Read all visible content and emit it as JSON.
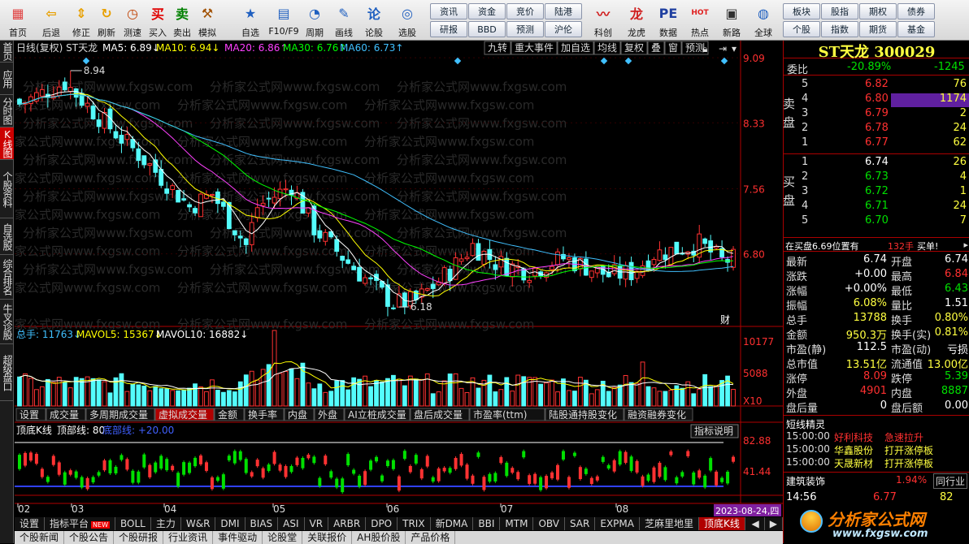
{
  "toolbar": {
    "nav": [
      {
        "label": "首页",
        "icon": "home-icon"
      },
      {
        "label": "后退",
        "icon": "back-arrow-icon"
      },
      {
        "label": "修正",
        "icon": "up-down-arrow-icon"
      },
      {
        "label": "刷新",
        "icon": "refresh-icon"
      },
      {
        "label": "测速",
        "icon": "clock-icon"
      },
      {
        "label": "买入",
        "icon": "buy-icon"
      },
      {
        "label": "卖出",
        "icon": "sell-icon"
      },
      {
        "label": "模拟",
        "icon": "hammer-icon"
      }
    ],
    "tools": [
      {
        "label": "自选",
        "icon": "favorites-icon"
      },
      {
        "label": "F10/F9",
        "icon": "f10-icon"
      },
      {
        "label": "周期",
        "icon": "period-icon"
      },
      {
        "label": "画线",
        "icon": "pen-icon"
      },
      {
        "label": "论股",
        "icon": "discuss-icon"
      },
      {
        "label": "选股",
        "icon": "stock-picker-icon"
      }
    ],
    "menu_grid": [
      [
        "资讯",
        "资金",
        "竞价",
        "陆港"
      ],
      [
        "研报",
        "BBD",
        "预测",
        "沪伦"
      ]
    ],
    "tools2": [
      {
        "label": "科创",
        "icon": "kechuang-icon"
      },
      {
        "label": "龙虎",
        "icon": "longhu-icon"
      },
      {
        "label": "数据",
        "icon": "pe-data-icon"
      },
      {
        "label": "热点",
        "icon": "hot-icon"
      },
      {
        "label": "新路",
        "icon": "new-road-icon"
      },
      {
        "label": "全球",
        "icon": "globe-icon"
      }
    ],
    "menu_grid2": [
      [
        "板块",
        "股指",
        "期权",
        "债券"
      ],
      [
        "个股",
        "指数",
        "期货",
        "基金"
      ]
    ]
  },
  "sidebar": [
    "首页",
    "应用",
    "分时图",
    "K线图",
    "个股资料",
    "自选股",
    "综合排名",
    "牛叉诊股",
    "超级盘口"
  ],
  "chart": {
    "header": "日线(复权)  ST天龙",
    "ma": [
      {
        "label": "MA5: 6.89↓",
        "color": "#ffffff"
      },
      {
        "label": "MA10: 6.94↓",
        "color": "#ffff00"
      },
      {
        "label": "MA20: 6.86↑",
        "color": "#ff40ff"
      },
      {
        "label": "MA30: 6.76↑",
        "color": "#00ff00"
      },
      {
        "label": "MA60: 6.73↑",
        "color": "#40c0ff"
      }
    ],
    "tools": [
      "九转",
      "重大事件",
      "加自选",
      "均线",
      "复权",
      "叠",
      "窗",
      "预测"
    ],
    "price_axis": [
      "9.09",
      "8.33",
      "7.56",
      "6.80"
    ],
    "high_label": "8.94",
    "low_label": "6.18",
    "cai_label": "财",
    "watermark": "分析家公式网www.fxgsw.com",
    "vol_header": {
      "total": "总手: 11763↓",
      "mavol5": "MAVOL5: 15367↓",
      "mavol10": "MAVOL10: 16882↓"
    },
    "vol_axis": [
      "10177",
      "5088",
      "X10"
    ],
    "vol_tabs": [
      "设置",
      "成交量",
      "多周期成交量",
      "虚拟成交量",
      "金额",
      "换手率",
      "内盘",
      "外盘",
      "AI立桩成交量",
      "盘后成交量",
      "市盈率(ttm)",
      "陆股通持股变化",
      "融资融券变化"
    ],
    "ind_header": {
      "name": "顶底K线",
      "top": "顶部线: 80",
      "bottom": "底部线: +20.00",
      "help": "指标说明"
    },
    "ind_axis": [
      "82.88",
      "41.44"
    ],
    "date_axis": [
      "02",
      "03",
      "04",
      "05",
      "06",
      "07",
      "08"
    ],
    "date_current": "2023-08-24,四",
    "bottom_tabs": [
      "设置",
      "指标平台",
      "BOLL",
      "主力",
      "W&R",
      "DMI",
      "BIAS",
      "ASI",
      "VR",
      "ARBR",
      "DPO",
      "TRIX",
      "新DMA",
      "BBI",
      "MTM",
      "OBV",
      "SAR",
      "EXPMA",
      "芝麻里地里",
      "顶底K线"
    ],
    "new_badge": "NEW",
    "bottom_tabs2": [
      "个股新闻",
      "个股公告",
      "个股研报",
      "行业资讯",
      "事件驱动",
      "论股堂",
      "关联报价",
      "AH股价股",
      "产品价格"
    ]
  },
  "right": {
    "title": "ST天龙 300029",
    "weibi_label": "委比",
    "weibi": "-20.89%",
    "weicha": "-1245",
    "sell_label": "卖盘",
    "buy_label": "买盘",
    "sell": [
      {
        "lvl": "5",
        "price": "6.82",
        "vol": "76"
      },
      {
        "lvl": "4",
        "price": "6.80",
        "vol": "1174"
      },
      {
        "lvl": "3",
        "price": "6.79",
        "vol": "2"
      },
      {
        "lvl": "2",
        "price": "6.78",
        "vol": "24"
      },
      {
        "lvl": "1",
        "price": "6.77",
        "vol": "62"
      }
    ],
    "buy": [
      {
        "lvl": "1",
        "price": "6.74",
        "vol": "26"
      },
      {
        "lvl": "2",
        "price": "6.73",
        "vol": "4"
      },
      {
        "lvl": "3",
        "price": "6.72",
        "vol": "1"
      },
      {
        "lvl": "4",
        "price": "6.71",
        "vol": "24"
      },
      {
        "lvl": "5",
        "price": "6.70",
        "vol": "7"
      }
    ],
    "pos_text": "在买盘6.69位置有",
    "pos_vol": "132手",
    "pos_btn": "买单!",
    "quotes": [
      {
        "l1": "最新",
        "v1": "6.74",
        "l2": "开盘",
        "v2": "6.74",
        "c1": "#fff",
        "c2": "#fff"
      },
      {
        "l1": "涨跌",
        "v1": "+0.00",
        "l2": "最高",
        "v2": "6.84",
        "c1": "#fff",
        "c2": "#ff3030"
      },
      {
        "l1": "涨幅",
        "v1": "+0.00%",
        "l2": "最低",
        "v2": "6.43",
        "c1": "#fff",
        "c2": "#00e000"
      },
      {
        "l1": "振幅",
        "v1": "6.08%",
        "l2": "量比",
        "v2": "1.51",
        "c1": "#ffff40",
        "c2": "#fff"
      },
      {
        "l1": "总手",
        "v1": "13788",
        "l2": "换手",
        "v2": "0.80%",
        "c1": "#ffff40",
        "c2": "#ffff40"
      },
      {
        "l1": "金额",
        "v1": "950.3万",
        "l2": "换手(实)",
        "v2": "0.81%",
        "c1": "#ffff40",
        "c2": "#ffff40"
      },
      {
        "l1": "市盈(静)",
        "v1": "112.5",
        "l2": "市盈(动)",
        "v2": "亏损",
        "c1": "#fff",
        "c2": "#fff"
      },
      {
        "l1": "总市值",
        "v1": "13.51亿",
        "l2": "流通值",
        "v2": "13.00亿",
        "c1": "#ffff40",
        "c2": "#ffff40"
      },
      {
        "l1": "涨停",
        "v1": "8.09",
        "l2": "跌停",
        "v2": "5.39",
        "c1": "#ff3030",
        "c2": "#00e000"
      },
      {
        "l1": "外盘",
        "v1": "4901",
        "l2": "内盘",
        "v2": "8887",
        "c1": "#ff3030",
        "c2": "#00e000"
      },
      {
        "l1": "盘后量",
        "v1": "0",
        "l2": "盘后额",
        "v2": "0.00",
        "c1": "#fff",
        "c2": "#fff"
      }
    ],
    "news_title": "短线精灵",
    "news": [
      {
        "time": "15:00:00",
        "stock": "好利科技",
        "event": "急速拉升",
        "color": "#ff3030"
      },
      {
        "time": "15:00:00",
        "stock": "华鑫股份",
        "event": "打开涨停板",
        "color": "#ffff40"
      },
      {
        "time": "15:00:00",
        "stock": "天晟新材",
        "event": "打开涨停板",
        "color": "#ffff40"
      }
    ],
    "sector": {
      "name": "建筑装饰",
      "pct": "1.94%",
      "btn": "同行业"
    },
    "tick": {
      "time": "14:56",
      "price": "6.77",
      "vol": "82"
    },
    "logo_text": "分析家公式网",
    "logo_url": "www.fxgsw.com"
  },
  "colors": {
    "up": "#ff3232",
    "down": "#54fcfc",
    "bg": "#000000",
    "axis": "#b00000"
  }
}
